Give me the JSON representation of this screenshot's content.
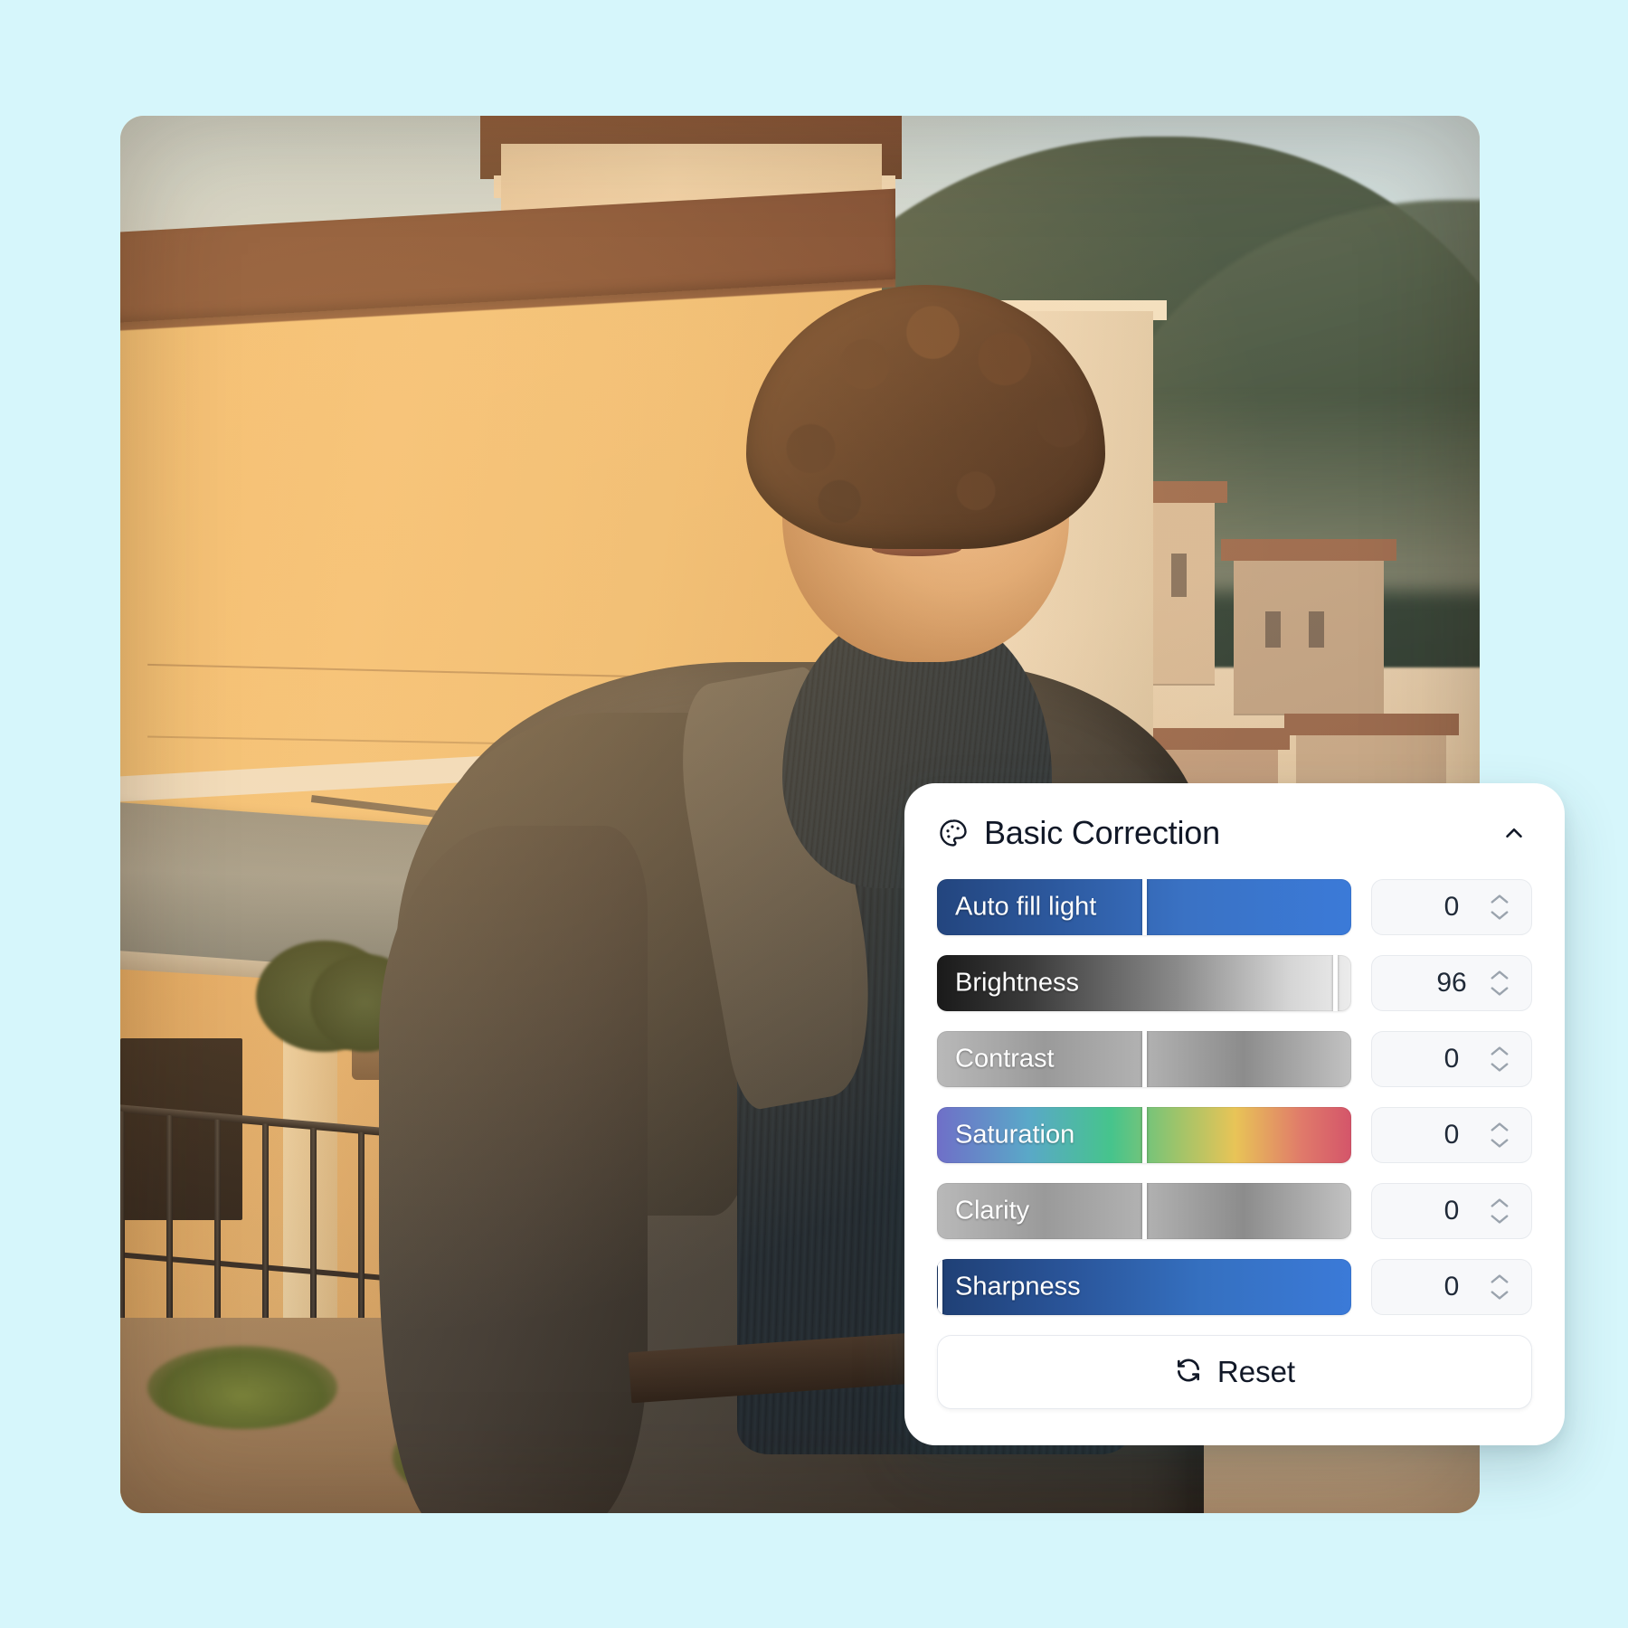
{
  "theme": {
    "background": "#d6f6fb",
    "panel_background": "#ffffff",
    "accent_blue": "#2f6fd0",
    "text_primary": "#111827"
  },
  "photo": {
    "alt": "Young man with curly hair in a dark denim jacket standing on a terrace above an Italian hillside town at golden hour",
    "corner_radius": "26px"
  },
  "panel": {
    "icon": "palette-icon",
    "title": "Basic Correction",
    "collapse_icon": "chevron-up-icon",
    "sliders": [
      {
        "label": "Auto fill light",
        "value": "0",
        "thumb_percent": 50,
        "gradient_name": "blue-ramp",
        "gradient": "linear-gradient(90deg,#23457e 0%,#2d5aa0 30%,#3a72c4 60%,#3b7ad8 100%)"
      },
      {
        "label": "Brightness",
        "value": "96",
        "thumb_percent": 96,
        "gradient_name": "black-to-white",
        "gradient": "linear-gradient(90deg,#1a1a1a 0%,#3a3a3a 22%,#8a8a8a 58%,#d5d5d5 85%,#ececec 100%)"
      },
      {
        "label": "Contrast",
        "value": "0",
        "thumb_percent": 50,
        "gradient_name": "gray-contrast",
        "gradient": "linear-gradient(90deg,#b9b9b9 0%,#9a9a9a 26%,#b2b2b2 50%,#8c8c8c 74%,#c2c2c2 100%)"
      },
      {
        "label": "Saturation",
        "value": "0",
        "thumb_percent": 50,
        "gradient_name": "rainbow",
        "gradient": "linear-gradient(90deg,#6f6fc8 0%,#5aa8c8 22%,#46c48c 42%,#9ec46a 58%,#e8c457 72%,#e07a6a 88%,#d4556a 100%)"
      },
      {
        "label": "Clarity",
        "value": "0",
        "thumb_percent": 50,
        "gradient_name": "gray-contrast",
        "gradient": "linear-gradient(90deg,#b9b9b9 0%,#9a9a9a 26%,#b2b2b2 50%,#8c8c8c 74%,#c2c2c2 100%)"
      },
      {
        "label": "Sharpness",
        "value": "0",
        "thumb_percent": 0.6,
        "gradient_name": "blue-ramp",
        "gradient": "linear-gradient(90deg,#1f3f74 0%,#2a559a 32%,#3570c0 64%,#3b7ad8 100%)"
      }
    ],
    "reset": {
      "icon": "refresh-icon",
      "label": "Reset"
    },
    "stepper_icons": {
      "up": "chevron-up-icon",
      "down": "chevron-down-icon"
    }
  }
}
